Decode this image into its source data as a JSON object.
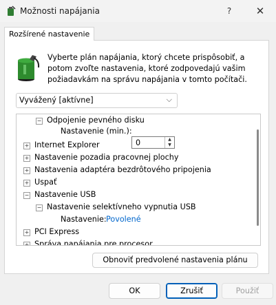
{
  "window": {
    "title": "Možnosti napájania",
    "help_glyph": "?",
    "close_glyph": "✕",
    "app_icon": "power-options-icon"
  },
  "tab": {
    "label": "Rozšírené nastavenie"
  },
  "description": "Vyberte plán napájania, ktorý chcete prispôsobiť, a potom zvoľte nastavenia, ktoré zodpovedajú vašim požiadavkám na správu napájania v tomto počítači.",
  "plan_select": {
    "value": "Vyvážený [aktívne]"
  },
  "tree": {
    "items": [
      {
        "label": "Odpojenie pevného disku",
        "expander": "−"
      },
      {
        "label": "Nastavenie (min.):",
        "spinner_value": "0"
      },
      {
        "label": "Internet Explorer",
        "expander": "+"
      },
      {
        "label": "Nastavenie pozadia pracovnej plochy",
        "expander": "+"
      },
      {
        "label": "Nastavenia adaptéra bezdrôtového pripojenia",
        "expander": "+"
      },
      {
        "label": "Uspať",
        "expander": "+"
      },
      {
        "label": "Nastavenie USB",
        "expander": "−"
      },
      {
        "label": "Nastavenie selektívneho vypnutia USB",
        "expander": "−"
      },
      {
        "label": "Nastavenie:",
        "value": "Povolené"
      },
      {
        "label": "PCI Express",
        "expander": "+"
      },
      {
        "label": "Správa napájania pre procesor",
        "expander": "+"
      }
    ]
  },
  "restore_button": "Obnoviť predvolené nastavenia plánu",
  "buttons": {
    "ok": "OK",
    "cancel": "Zrušiť",
    "apply": "Použiť"
  },
  "colors": {
    "link_value": "#0066cc",
    "accent": "#005fb8"
  }
}
